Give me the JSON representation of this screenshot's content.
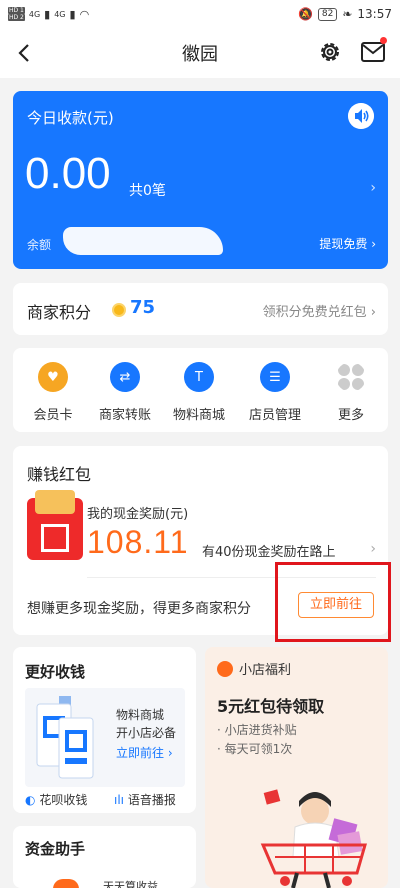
{
  "status_bar": {
    "hd1": "HD 1",
    "hd2": "HD 2",
    "signal1": "4G",
    "signal2": "4G",
    "battery": "82",
    "time": "13:57"
  },
  "nav": {
    "title": "徽园"
  },
  "today": {
    "label": "今日收款(元)",
    "amount": "0.00",
    "count": "共0笔",
    "balance_label": "余额",
    "withdraw": "提现免费"
  },
  "points": {
    "label": "商家积分",
    "value": "75",
    "link": "领积分免费兑红包"
  },
  "grid": [
    {
      "label": "会员卡",
      "color": "#f6a623",
      "icon": "heart-icon"
    },
    {
      "label": "商家转账",
      "color": "#1777ff",
      "icon": "transfer-icon"
    },
    {
      "label": "物料商城",
      "color": "#1777ff",
      "icon": "t-shirt-icon"
    },
    {
      "label": "店员管理",
      "color": "#1777ff",
      "icon": "staff-icon"
    },
    {
      "label": "更多",
      "color": "#cccccc",
      "icon": "more-icon"
    }
  ],
  "earn": {
    "title": "赚钱红包",
    "reward_label": "我的现金奖励(元)",
    "reward_value": "108.11",
    "reward_note": "有40份现金奖励在路上",
    "footer": "想赚更多现金奖励，得更多商家积分",
    "cta": "立即前往"
  },
  "better": {
    "title": "更好收钱",
    "line1": "物料商城",
    "line2": "开小店必备",
    "link": "立即前往",
    "foot1": "花呗收钱",
    "foot2": "语音播报"
  },
  "welfare": {
    "header": "小店福利",
    "title": "5元红包待领取",
    "line1": "· 小店进货补贴",
    "line2": "· 每天可领1次"
  },
  "fund": {
    "title": "资金助手",
    "teaser": "天天算收益"
  }
}
